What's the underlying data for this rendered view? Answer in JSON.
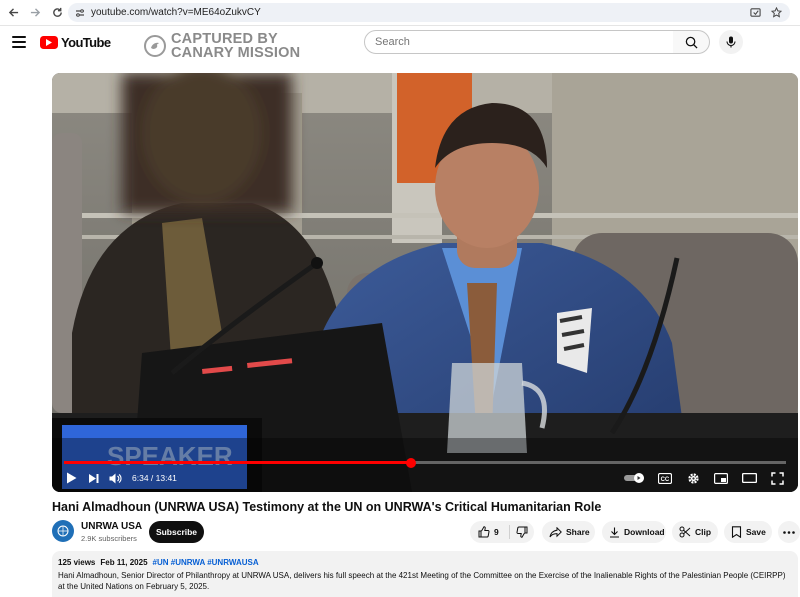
{
  "browser": {
    "url": "youtube.com/watch?v=ME64oZukvCY"
  },
  "header": {
    "logo_text": "YouTube",
    "watermark_line1": "CAPTURED BY",
    "watermark_line2": "CANARY MISSION",
    "search_placeholder": "Search"
  },
  "player": {
    "time_current": "6:34",
    "time_separator": " / ",
    "time_total": "13:41",
    "progress": 0.48,
    "nameplate_text": "SPEAKER",
    "cc_label": "CC"
  },
  "video": {
    "title": "Hani Almadhoun (UNRWA USA) Testimony at the UN on UNRWA's Critical Humanitarian Role",
    "channel_name": "UNRWA USA",
    "subscribers": "2.9K subscribers",
    "subscribe_label": "Subscribe",
    "likes": "9",
    "share_label": "Share",
    "download_label": "Download",
    "clip_label": "Clip",
    "save_label": "Save",
    "views": "125 views",
    "date": "Feb 11, 2025",
    "hashtags": "#UN #UNRWA #UNRWAUSA",
    "description": "Hani Almadhoun, Senior Director of Philanthropy at UNRWA USA, delivers his full speech at the 421st Meeting of the Committee on the Exercise of the Inalienable Rights of the Palestinian People (CEIRPP) at the United Nations on February 5, 2025."
  },
  "colors": {
    "brand_red": "#ff0000",
    "link_blue": "#065fd4",
    "text": "#0f0f0f"
  }
}
